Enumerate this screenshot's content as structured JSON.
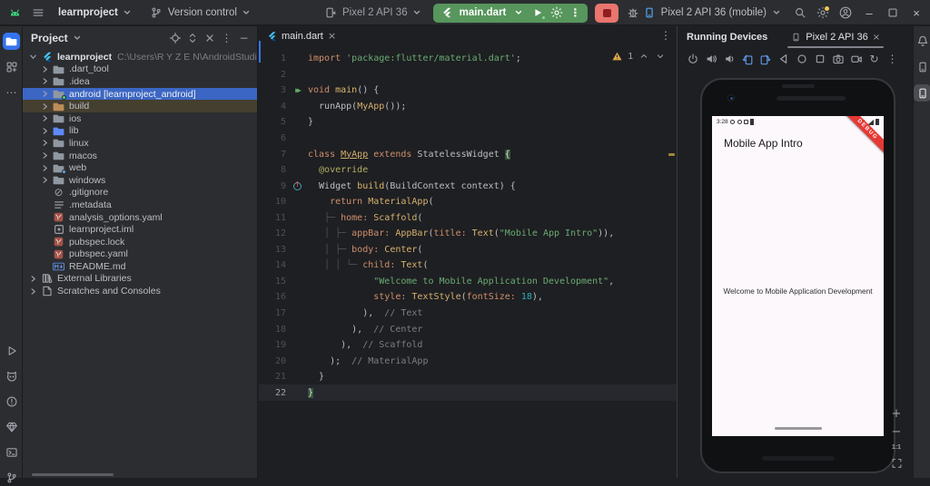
{
  "toolbar": {
    "project_name": "learnproject",
    "version_control_label": "Version control",
    "device_selector": "Pixel 2 API 36",
    "run_config": "main.dart",
    "device_mirror": "Pixel 2 API 36 (mobile)"
  },
  "left_sidebar": {
    "top": [
      {
        "icon": "folder-tool",
        "name": "project-tool-window",
        "selected": "blue"
      },
      {
        "icon": "structure",
        "name": "resource-manager-tool-window"
      },
      {
        "icon": "more-h",
        "name": "more-tool-windows"
      }
    ],
    "bottom": [
      {
        "icon": "run-outline",
        "name": "run-tool-window"
      },
      {
        "icon": "logcat",
        "name": "logcat-tool-window"
      },
      {
        "icon": "problems",
        "name": "problems-tool-window"
      },
      {
        "icon": "gem",
        "name": "dart-analysis-tool-window"
      },
      {
        "icon": "terminal",
        "name": "terminal-tool-window"
      },
      {
        "icon": "branch",
        "name": "version-control-tool-window"
      }
    ]
  },
  "right_sidebar": {
    "icons": [
      {
        "icon": "bell",
        "name": "notifications-tool-window"
      },
      {
        "icon": "device-phone",
        "name": "device-manager-tool-window"
      },
      {
        "icon": "device-phone",
        "name": "running-devices-tool-window",
        "selected": "gray"
      }
    ]
  },
  "project_panel": {
    "title": "Project",
    "header_icons": [
      {
        "icon": "crosshair",
        "name": "locate-opened-file"
      },
      {
        "icon": "expand-all",
        "name": "expand-all"
      },
      {
        "icon": "close-x",
        "name": "collapse-all"
      },
      {
        "icon": "kebab",
        "name": "options-menu"
      },
      {
        "icon": "minus",
        "name": "hide-panel"
      }
    ],
    "tree": [
      {
        "label": "learnproject",
        "suffix": "C:\\Users\\R Y Z E N\\AndroidStudioProject",
        "icon": "flutter",
        "chevron": "down",
        "level": 0,
        "bold": true
      },
      {
        "label": ".dart_tool",
        "icon": "folder",
        "chevron": "right",
        "level": 1
      },
      {
        "label": ".idea",
        "icon": "folder-idea",
        "chevron": "right",
        "level": 1
      },
      {
        "label": "android [learnproject_android]",
        "icon": "folder-android",
        "chevron": "right",
        "level": 1,
        "selected": true
      },
      {
        "label": "build",
        "icon": "folder-excluded",
        "chevron": "right",
        "level": 1,
        "excluded": true
      },
      {
        "label": "ios",
        "icon": "folder-ios",
        "chevron": "right",
        "level": 1
      },
      {
        "label": "lib",
        "icon": "folder-lib",
        "chevron": "right",
        "level": 1
      },
      {
        "label": "linux",
        "icon": "folder",
        "chevron": "right",
        "level": 1
      },
      {
        "label": "macos",
        "icon": "folder",
        "chevron": "right",
        "level": 1
      },
      {
        "label": "web",
        "icon": "folder-web",
        "chevron": "right",
        "level": 1
      },
      {
        "label": "windows",
        "icon": "folder",
        "chevron": "right",
        "level": 1
      },
      {
        "label": ".gitignore",
        "icon": "ignore",
        "level": 1
      },
      {
        "label": ".metadata",
        "icon": "textfile",
        "level": 1
      },
      {
        "label": "analysis_options.yaml",
        "icon": "yaml",
        "level": 1
      },
      {
        "label": "learnproject.iml",
        "icon": "iml",
        "level": 1
      },
      {
        "label": "pubspec.lock",
        "icon": "yaml",
        "level": 1
      },
      {
        "label": "pubspec.yaml",
        "icon": "yaml",
        "level": 1
      },
      {
        "label": "README.md",
        "icon": "markdown",
        "level": 1
      },
      {
        "label": "External Libraries",
        "icon": "libraries",
        "chevron": "right",
        "level": 0
      },
      {
        "label": "Scratches and Consoles",
        "icon": "scratches",
        "chevron": "right",
        "level": 0
      }
    ]
  },
  "editor": {
    "tab_label": "main.dart",
    "warning_count": "1",
    "lines": [
      {
        "n": "1",
        "t": [
          [
            "kw",
            "import "
          ],
          [
            "str",
            "'package:flutter/material.dart'"
          ],
          [
            "pl",
            ";"
          ]
        ]
      },
      {
        "n": "2",
        "t": []
      },
      {
        "n": "3",
        "g": "run",
        "t": [
          [
            "kw",
            "void "
          ],
          [
            "fn",
            "main"
          ],
          [
            "pl",
            "() {"
          ]
        ]
      },
      {
        "n": "4",
        "t": [
          [
            "pl",
            "  runApp("
          ],
          [
            "cls",
            "MyApp"
          ],
          [
            "pl",
            "());"
          ]
        ]
      },
      {
        "n": "5",
        "t": [
          [
            "pl",
            "}"
          ]
        ]
      },
      {
        "n": "6",
        "t": []
      },
      {
        "n": "7",
        "t": [
          [
            "kw",
            "class "
          ],
          [
            "clsu",
            "MyApp"
          ],
          [
            "kw",
            " extends "
          ],
          [
            "pl",
            "StatelessWidget "
          ],
          [
            "bh",
            "{"
          ]
        ]
      },
      {
        "n": "8",
        "t": [
          [
            "ann",
            "  @override"
          ]
        ]
      },
      {
        "n": "9",
        "g": "override",
        "t": [
          [
            "pl",
            "  Widget "
          ],
          [
            "fn",
            "build"
          ],
          [
            "pl",
            "(BuildContext context) {"
          ]
        ]
      },
      {
        "n": "10",
        "t": [
          [
            "kw",
            "    return "
          ],
          [
            "cls",
            "MaterialApp"
          ],
          [
            "pl",
            "("
          ]
        ]
      },
      {
        "n": "11",
        "t": [
          [
            "sm",
            "   ├─ "
          ],
          [
            "arg",
            "home: "
          ],
          [
            "cls",
            "Scaffold"
          ],
          [
            "pl",
            "("
          ]
        ]
      },
      {
        "n": "12",
        "t": [
          [
            "sm",
            "   │ ├─ "
          ],
          [
            "arg",
            "appBar: "
          ],
          [
            "cls",
            "AppBar"
          ],
          [
            "pl",
            "("
          ],
          [
            "arg",
            "title: "
          ],
          [
            "cls",
            "Text"
          ],
          [
            "pl",
            "("
          ],
          [
            "str",
            "\"Mobile App Intro\""
          ],
          [
            "pl",
            ")),"
          ]
        ]
      },
      {
        "n": "13",
        "t": [
          [
            "sm",
            "   │ ├─ "
          ],
          [
            "arg",
            "body: "
          ],
          [
            "cls",
            "Center"
          ],
          [
            "pl",
            "("
          ]
        ]
      },
      {
        "n": "14",
        "t": [
          [
            "sm",
            "   │ │ └─ "
          ],
          [
            "arg",
            "child: "
          ],
          [
            "cls",
            "Text"
          ],
          [
            "pl",
            "("
          ]
        ]
      },
      {
        "n": "15",
        "t": [
          [
            "pl",
            "            "
          ],
          [
            "str",
            "\"Welcome to Mobile Application Development\""
          ],
          [
            "pl",
            ","
          ]
        ]
      },
      {
        "n": "16",
        "t": [
          [
            "pl",
            "            "
          ],
          [
            "arg",
            "style: "
          ],
          [
            "cls",
            "TextStyle"
          ],
          [
            "pl",
            "("
          ],
          [
            "arg",
            "fontSize: "
          ],
          [
            "num",
            "18"
          ],
          [
            "pl",
            "),"
          ]
        ]
      },
      {
        "n": "17",
        "t": [
          [
            "pl",
            "          ),  "
          ],
          [
            "cmt",
            "// Text"
          ]
        ]
      },
      {
        "n": "18",
        "t": [
          [
            "pl",
            "        ),  "
          ],
          [
            "cmt",
            "// Center"
          ]
        ]
      },
      {
        "n": "19",
        "t": [
          [
            "pl",
            "      ),  "
          ],
          [
            "cmt",
            "// Scaffold"
          ]
        ]
      },
      {
        "n": "20",
        "t": [
          [
            "pl",
            "    );  "
          ],
          [
            "cmt",
            "// MaterialApp"
          ]
        ]
      },
      {
        "n": "21",
        "t": [
          [
            "pl",
            "  }"
          ]
        ]
      },
      {
        "n": "22",
        "cur": true,
        "t": [
          [
            "bh",
            "}"
          ]
        ]
      }
    ]
  },
  "devices": {
    "title": "Running Devices",
    "tab_label": "Pixel 2 API 36",
    "toolbar_icons": [
      {
        "icon": "power",
        "name": "power-button"
      },
      {
        "icon": "volume-up",
        "name": "volume-up-button"
      },
      {
        "icon": "volume-down",
        "name": "volume-down-button"
      },
      {
        "icon": "rotate-left",
        "name": "rotate-left-button"
      },
      {
        "icon": "rotate-right",
        "name": "rotate-right-button"
      },
      {
        "icon": "back",
        "name": "back-button"
      },
      {
        "icon": "home",
        "name": "home-button"
      },
      {
        "icon": "overview",
        "name": "overview-button"
      },
      {
        "icon": "screenshot",
        "name": "screenshot-button"
      },
      {
        "icon": "record",
        "name": "screen-record-button"
      },
      {
        "icon": "restart",
        "name": "restart-button"
      },
      {
        "icon": "kebab",
        "name": "more-button"
      }
    ],
    "zoom": {
      "in": "+",
      "out": "−",
      "ratio": "1:1"
    },
    "phone": {
      "time": "3:28",
      "app_title": "Mobile App Intro",
      "body_text": "Welcome to Mobile Application Development",
      "debug_label": "DEBUG"
    }
  },
  "colors": {
    "run_pill_green": "#57965c",
    "stop_red": "#e8756e",
    "selection_blue": "#3b66c4",
    "debug_banner_red": "#e53935",
    "flutter_blue": "#47c5fb",
    "warning_yellow": "#d9a74c",
    "android_green": "#3ddc84"
  }
}
